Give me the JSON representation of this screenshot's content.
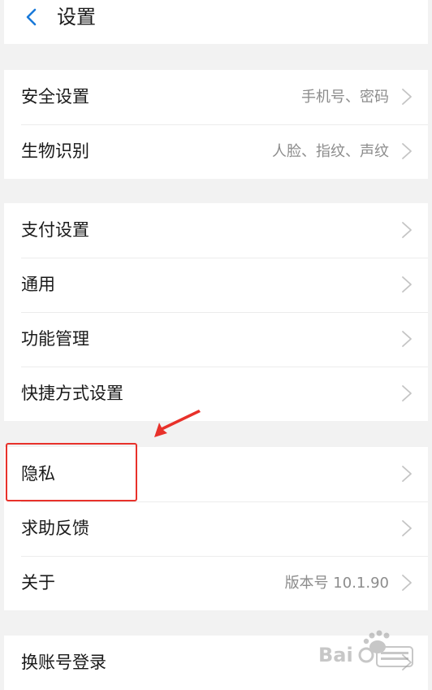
{
  "header": {
    "back_icon": "chevron-left-icon",
    "title": "设置"
  },
  "groups": [
    {
      "items": [
        {
          "label": "安全设置",
          "value": "手机号、密码"
        },
        {
          "label": "生物识别",
          "value": "人脸、指纹、声纹"
        }
      ]
    },
    {
      "items": [
        {
          "label": "支付设置",
          "value": ""
        },
        {
          "label": "通用",
          "value": ""
        },
        {
          "label": "功能管理",
          "value": ""
        },
        {
          "label": "快捷方式设置",
          "value": ""
        }
      ]
    },
    {
      "items": [
        {
          "label": "隐私",
          "value": ""
        },
        {
          "label": "求助反馈",
          "value": ""
        },
        {
          "label": "关于",
          "value": "版本号 10.1.90"
        }
      ]
    },
    {
      "items": [
        {
          "label": "换账号登录",
          "value": ""
        }
      ]
    }
  ],
  "colors": {
    "accent": "#1a7ad9",
    "annotation": "#e8312a",
    "background": "#f2f2f2",
    "secondary_text": "#8c8c8c"
  },
  "watermark": {
    "logo_text": "Baidu经验"
  }
}
